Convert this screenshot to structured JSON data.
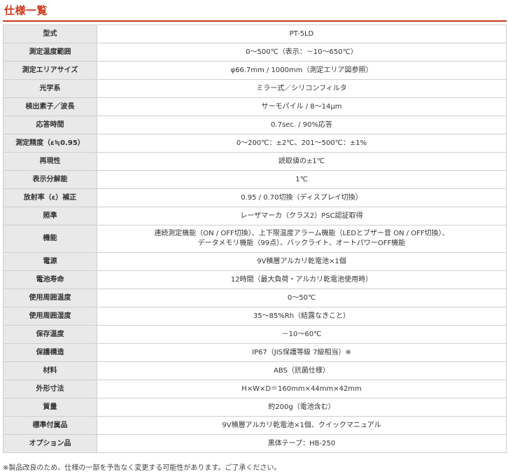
{
  "section_title": "仕様一覧",
  "rows": [
    {
      "label": "型式",
      "value": "PT-5LD"
    },
    {
      "label": "測定温度範囲",
      "value": "0～500℃（表示：－10～650℃）"
    },
    {
      "label": "測定エリアサイズ",
      "value": "φ66.7mm / 1000mm（測定エリア図参照）"
    },
    {
      "label": "光学系",
      "value": "ミラー式／シリコンフィルタ"
    },
    {
      "label": "検出素子／波長",
      "value": "サーモパイル / 8～14μm"
    },
    {
      "label": "応答時間",
      "value": "0.7sec. / 90%応答"
    },
    {
      "label": "測定精度（ε≒0.95）",
      "value": "0～200℃：±2℃、201～500℃：±1%"
    },
    {
      "label": "再現性",
      "value": "読取値の±1℃"
    },
    {
      "label": "表示分解能",
      "value": "1℃"
    },
    {
      "label": "放射率（ε）補正",
      "value": "0.95 / 0.70切換（ディスプレイ切換）"
    },
    {
      "label": "照準",
      "value": "レーザマーカ（クラス2）PSC認証取得"
    },
    {
      "label": "機能",
      "value": "連続測定機能（ON / OFF切換）、上下限温度アラーム機能（LEDとブザー音 ON / OFF切換）、",
      "value2": "データメモリ機能（99点）、バックライト、オートパワーOFF機能"
    },
    {
      "label": "電源",
      "value": "9V積層アルカリ乾電池×1個"
    },
    {
      "label": "電池寿命",
      "value": "12時間（最大負荷・アルカリ乾電池使用時）"
    },
    {
      "label": "使用周囲温度",
      "value": "0～50℃"
    },
    {
      "label": "使用周囲湿度",
      "value": "35～85%Rh（結露なきこと）"
    },
    {
      "label": "保存温度",
      "value": "－10～60℃"
    },
    {
      "label": "保護構造",
      "value": "IP67（JIS保護等級 7級相当）※"
    },
    {
      "label": "材料",
      "value": "ABS（抗菌仕様）"
    },
    {
      "label": "外形寸法",
      "value": "H×W×D＝160mm×44mm×42mm"
    },
    {
      "label": "質量",
      "value": "約200g（電池含む）"
    },
    {
      "label": "標準付属品",
      "value": "9V積層アルカリ乾電池×1個、クイックマニュアル"
    },
    {
      "label": "オプション品",
      "value": "黒体テープ：HB-250"
    }
  ],
  "footnote": "※製品改良のため、仕様の一部を予告なく変更する可能性があります。ご了承ください。"
}
